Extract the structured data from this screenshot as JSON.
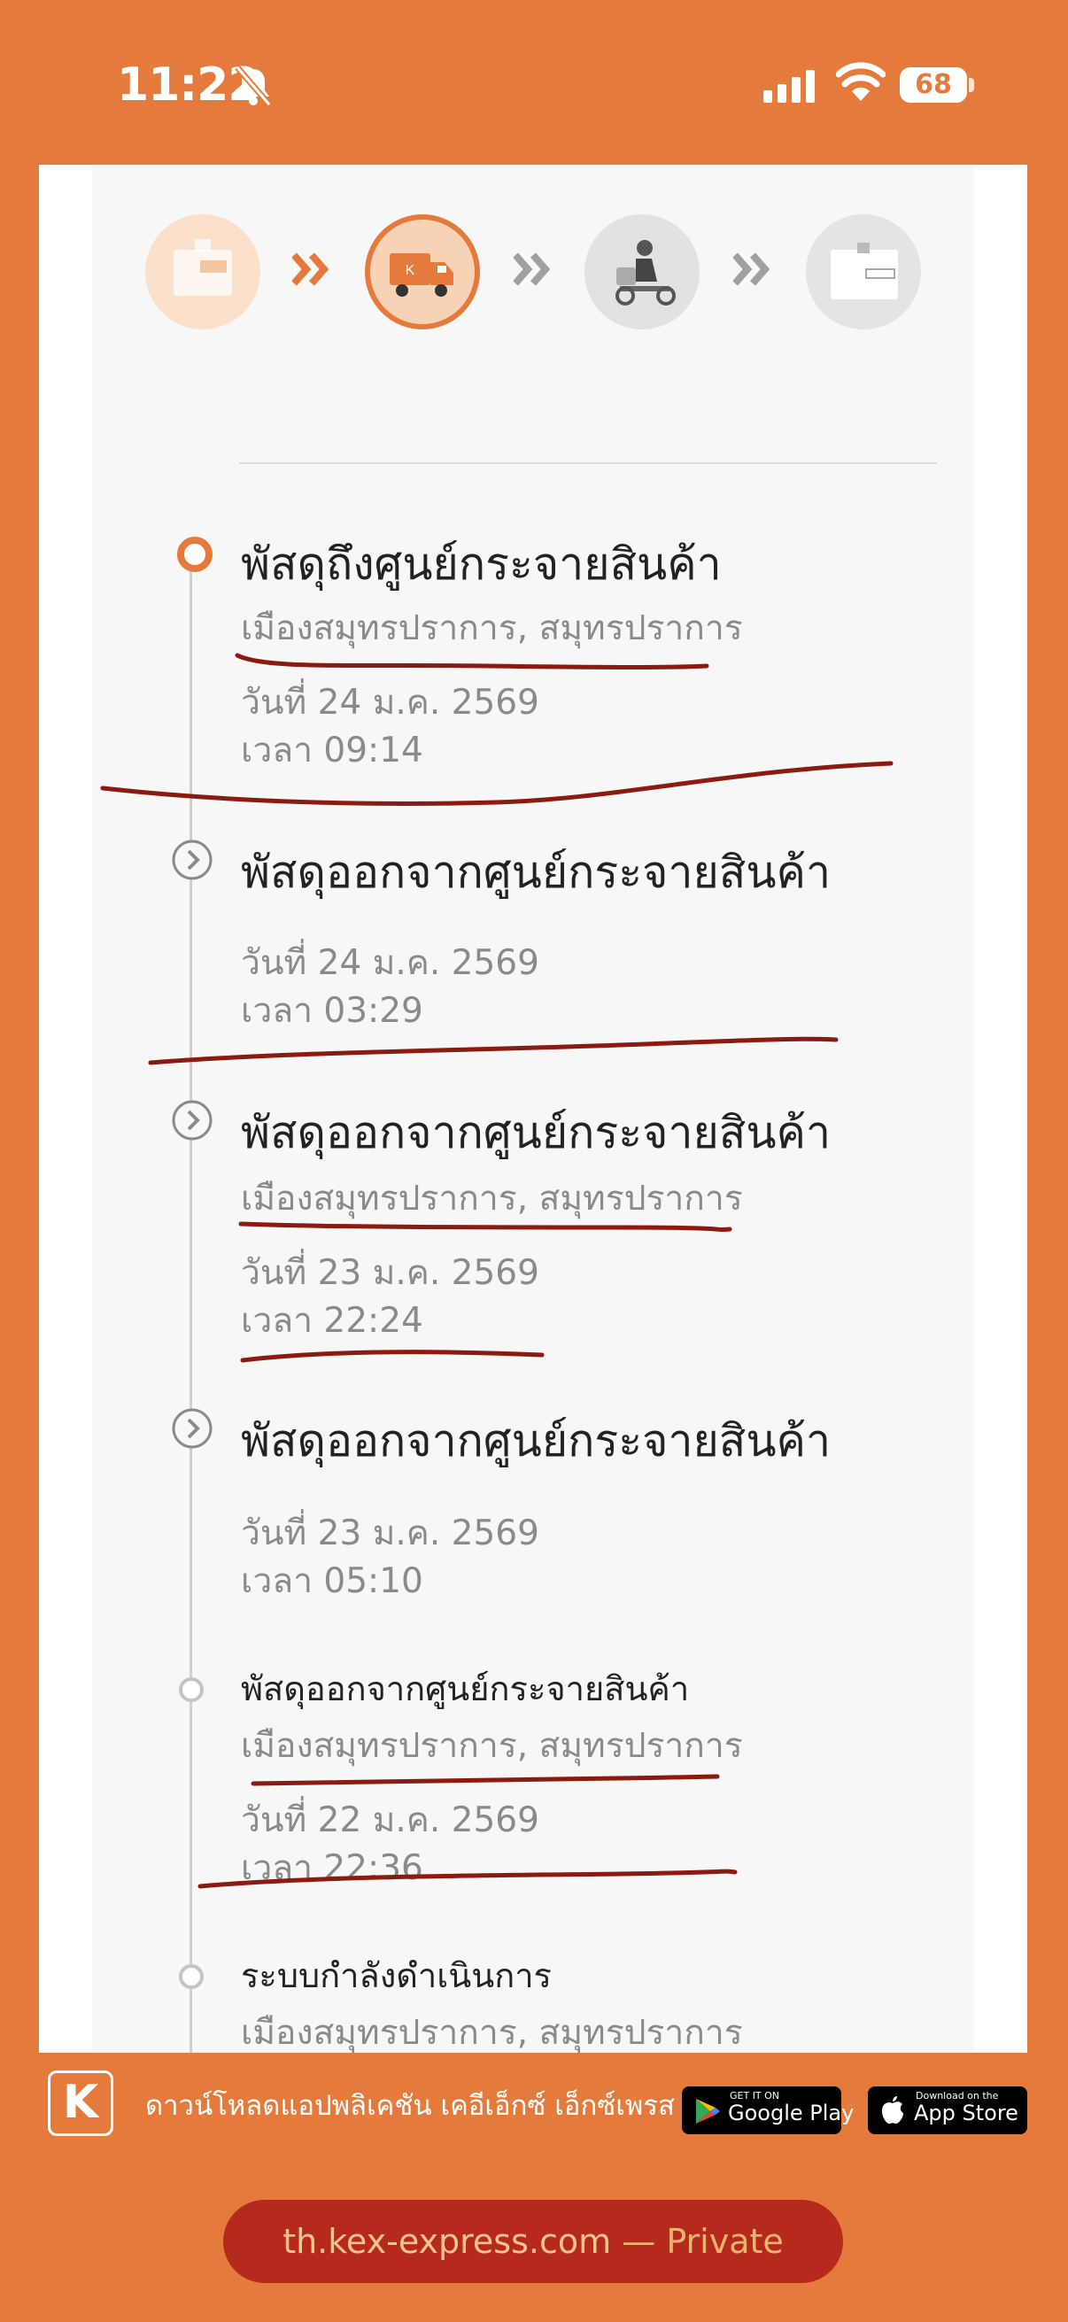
{
  "status_bar": {
    "time": "11:22",
    "battery": "68"
  },
  "tracking": {
    "steps": [
      {
        "name": "received",
        "state": "done"
      },
      {
        "name": "in-transit",
        "state": "current"
      },
      {
        "name": "out-for-delivery",
        "state": "pending"
      },
      {
        "name": "delivered",
        "state": "pending"
      }
    ],
    "events": [
      {
        "title": "พัสดุถึงศูนย์กระจายสินค้า",
        "location": "เมืองสมุทรปราการ, สมุทรปราการ",
        "date": "วันที่ 24 ม.ค. 2569",
        "time": "เวลา 09:14"
      },
      {
        "title": "พัสดุออกจากศูนย์กระจายสินค้า",
        "location": "",
        "date": "วันที่ 24 ม.ค. 2569",
        "time": "เวลา 03:29"
      },
      {
        "title": "พัสดุออกจากศูนย์กระจายสินค้า",
        "location": "เมืองสมุทรปราการ, สมุทรปราการ",
        "date": "วันที่ 23 ม.ค. 2569",
        "time": "เวลา 22:24"
      },
      {
        "title": "พัสดุออกจากศูนย์กระจายสินค้า",
        "location": "",
        "date": "วันที่ 23 ม.ค. 2569",
        "time": "เวลา 05:10"
      },
      {
        "title": "พัสดุออกจากศูนย์กระจายสินค้า",
        "location": "เมืองสมุทรปราการ, สมุทรปราการ",
        "date": "วันที่ 22 ม.ค. 2569",
        "time": "เวลา 22:36"
      },
      {
        "title": "ระบบกำลังดำเนินการ",
        "location": "เมืองสมุทรปราการ, สมุทรปราการ"
      }
    ]
  },
  "banner": {
    "logo": "K",
    "text": "ดาวน์โหลดแอปพลิเคชัน เคอีเอ็กซ์ เอ็กซ์เพรส",
    "google_play_small": "GET IT ON",
    "google_play": "Google Play",
    "app_store_small": "Download on the",
    "app_store": "App Store"
  },
  "browser": {
    "host": "th.kex-express.com",
    "separator": " — ",
    "mode": "Private"
  },
  "colors": {
    "brand_orange": "#e47a3b",
    "annotation_red": "#8b1a10"
  }
}
